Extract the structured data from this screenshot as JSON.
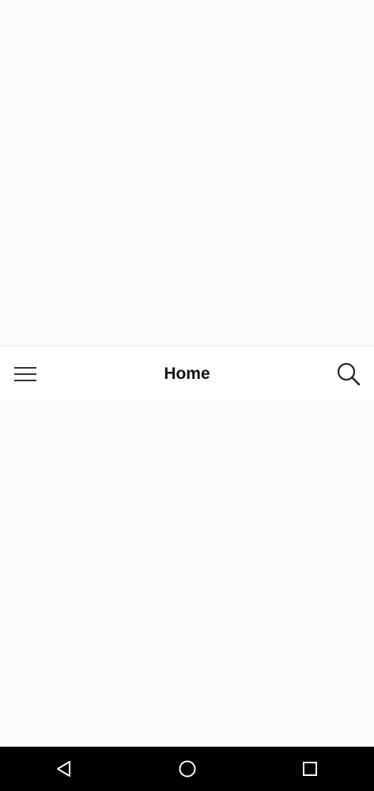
{
  "app_bar": {
    "title": "Home",
    "menu_icon": "hamburger-menu-icon",
    "search_icon": "search-icon"
  },
  "system_nav": {
    "back_icon": "back-triangle-icon",
    "home_icon": "home-circle-icon",
    "recents_icon": "recents-square-icon"
  }
}
